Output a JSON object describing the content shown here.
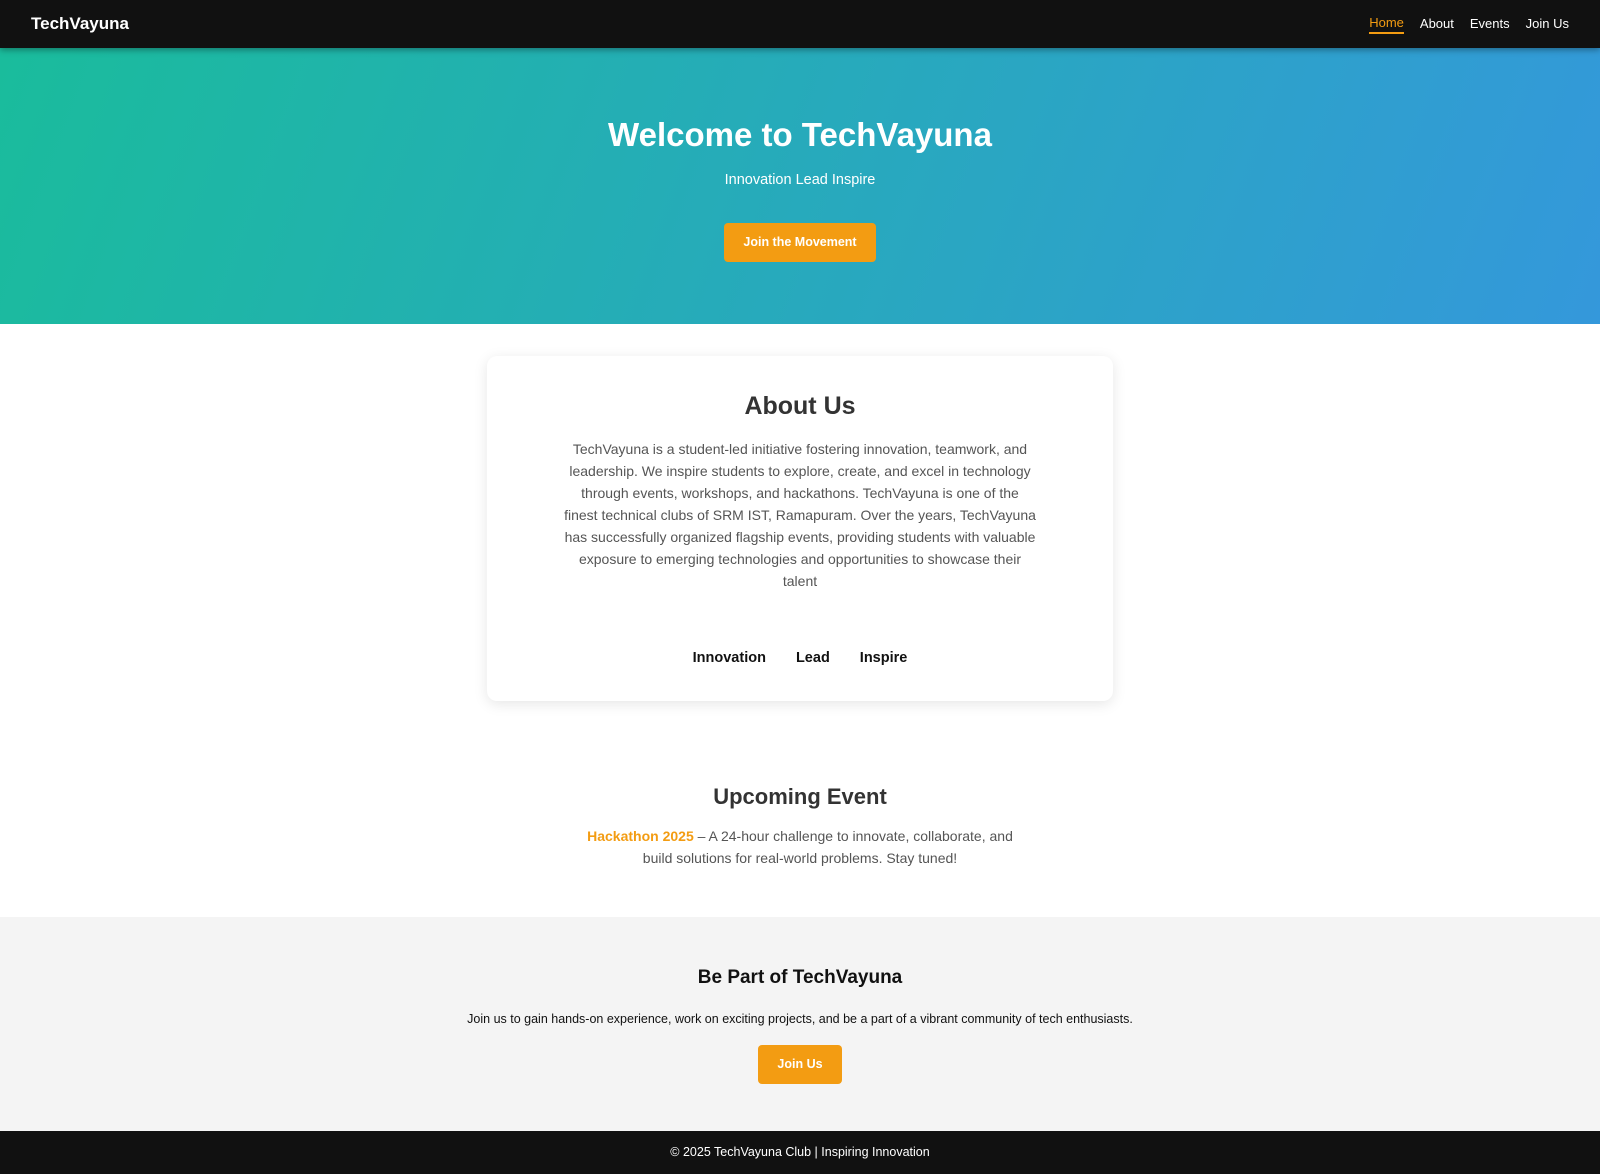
{
  "navbar": {
    "brand": "TechVayuna",
    "links": [
      {
        "label": "Home",
        "active": true
      },
      {
        "label": "About",
        "active": false
      },
      {
        "label": "Events",
        "active": false
      },
      {
        "label": "Join Us",
        "active": false
      }
    ]
  },
  "hero": {
    "title": "Welcome to TechVayuna",
    "tagline": "Innovation Lead Inspire",
    "button_label": "Join the Movement"
  },
  "about": {
    "title": "About Us",
    "text": "TechVayuna is a student-led initiative fostering innovation, teamwork, and leadership. We inspire students to explore, create, and excel in technology through events, workshops, and hackathons. TechVayuna is one of the finest technical clubs of SRM IST, Ramapuram. Over the years, TechVayuna has successfully organized flagship events, providing students with valuable exposure to emerging technologies and opportunities to showcase their talent",
    "values": [
      "Innovation",
      "Lead",
      "Inspire"
    ]
  },
  "event": {
    "title": "Upcoming Event",
    "highlight": "Hackathon 2025",
    "description": " – A 24-hour challenge to innovate, collaborate, and build solutions for real-world problems. Stay tuned!"
  },
  "join": {
    "title": "Be Part of TechVayuna",
    "text": "Join us to gain hands-on experience, work on exciting projects, and be a part of a vibrant community of tech enthusiasts.",
    "button_label": "Join Us"
  },
  "footer": {
    "text": "© 2025 TechVayuna Club | Inspiring Innovation"
  },
  "colors": {
    "accent": "#f39c12",
    "nav_bg": "#111111",
    "hero_gradient_start": "#1abc9c",
    "hero_gradient_end": "#3498db"
  }
}
